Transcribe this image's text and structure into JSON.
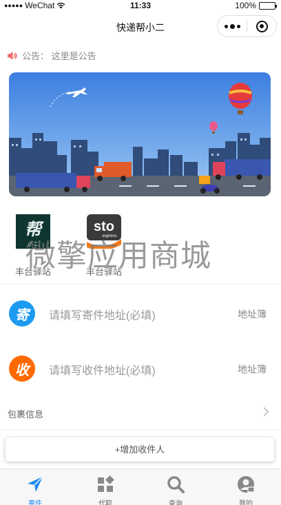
{
  "status_bar": {
    "carrier": "WeChat",
    "time": "11:33",
    "battery": "100%"
  },
  "nav": {
    "title": "快递帮小二"
  },
  "notice": {
    "text": "公告：  这里是公告"
  },
  "stations": [
    {
      "label": "丰台驿站",
      "logo_text": "帮",
      "logo_subtext": "小二"
    },
    {
      "label": "丰台驿站",
      "logo_text": "sto",
      "logo_subtext": "express"
    }
  ],
  "watermark": "微擎应用商城",
  "sender": {
    "badge": "寄",
    "placeholder": "请填写寄件地址(必填)",
    "address_book": "地址簿",
    "color": "#1d9bf0"
  },
  "receiver": {
    "badge": "收",
    "placeholder": "请填写收件地址(必填)",
    "address_book": "地址簿",
    "color": "#ff6a00"
  },
  "package": {
    "label": "包裹信息"
  },
  "add_receiver": "+增加收件人",
  "tabs": [
    {
      "label": "寄件",
      "icon": "send-icon",
      "active": true
    },
    {
      "label": "代取",
      "icon": "apps-icon",
      "active": false
    },
    {
      "label": "查询",
      "icon": "search-icon",
      "active": false
    },
    {
      "label": "我的",
      "icon": "user-icon",
      "active": false
    }
  ],
  "colors": {
    "accent": "#1b8bf0",
    "inactive": "#888888"
  }
}
